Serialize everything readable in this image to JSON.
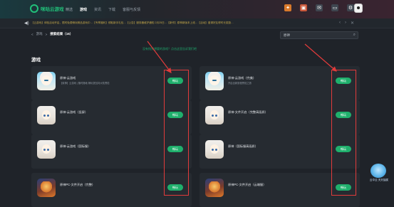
{
  "header": {
    "logo_text": "咪咕云游戏",
    "nav": [
      "精选",
      "游戏",
      "资讯",
      "下载",
      "客服与反馈"
    ],
    "active_nav": "游戏"
  },
  "notice": {
    "message": "【云游戏】体验活动开启，限时免费畅玩精品游戏中…【专享福利】领取新手礼包…【公告】服务器维护通知 2月25日…【新作】原神新版本上线…【活动】邀请好友得时长奖励…",
    "controls": [
      "‹",
      "›",
      "✕"
    ]
  },
  "breadcrumb": {
    "home": "游戏",
    "sep": ">",
    "current": "搜索结果（16）"
  },
  "search": {
    "value": "原神",
    "placeholder": "搜索游戏"
  },
  "tip": "没有找到想要的游戏？点击这里告诉我们吧",
  "section_title": "游戏",
  "games": [
    {
      "title": "原神-云游戏",
      "sub": "【原神】云游戏 | 随时随地 畅玩提瓦特大陆冒险",
      "btn": "畅玩"
    },
    {
      "title": "原神-云游戏（完美）",
      "sub": "开启全新旅程冒险之旅",
      "btn": "畅玩"
    },
    {
      "title": "原神-云游戏（竖屏）",
      "sub": "",
      "btn": "畅玩"
    },
    {
      "title": "原神-文件开启（完整高画质）",
      "sub": "",
      "btn": "畅玩"
    },
    {
      "title": "原神-云游戏（国际服）",
      "sub": "",
      "btn": "畅玩"
    },
    {
      "title": "原神（国际服高画质）",
      "sub": "",
      "btn": "畅玩"
    },
    {
      "title": "原神PC-文件开启（完整）",
      "sub": "",
      "btn": "畅玩"
    },
    {
      "title": "原神PC-文件开启（云端服）",
      "sub": "",
      "btn": "畅玩"
    }
  ],
  "float_ad": {
    "label": "云中云 天天抽奖"
  },
  "colors": {
    "accent": "#1fb06c",
    "highlight": "#e23b3b",
    "bg": "#1f2329",
    "card": "#262b31"
  }
}
